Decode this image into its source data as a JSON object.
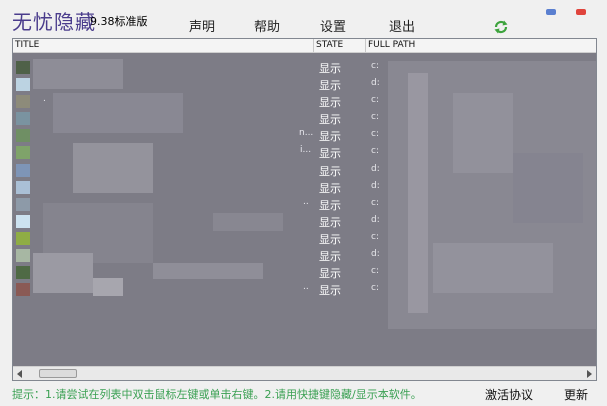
{
  "app": {
    "title": "无忧隐藏",
    "version": "9.38标准版"
  },
  "menu": [
    {
      "label": "声明"
    },
    {
      "label": "帮助"
    },
    {
      "label": "设置"
    },
    {
      "label": "退出"
    }
  ],
  "icons": {
    "refresh": "refresh-icon",
    "minimize": "minimize-icon",
    "close": "close-icon"
  },
  "colors": {
    "title": "#4a3c8c",
    "tip": "#3aa052",
    "list_overlay": "#7d7c86"
  },
  "table": {
    "columns": [
      "TITLE",
      "STATE",
      "FULL PATH"
    ],
    "rows": [
      {
        "swatch": "#4f6148",
        "tail": "",
        "state": "显示",
        "path": "c:"
      },
      {
        "swatch": "#bcd3e2",
        "tail": "",
        "state": "显示",
        "path": "d:"
      },
      {
        "swatch": "#8d8b7a",
        "tail": ".",
        "state": "显示",
        "path": "c:"
      },
      {
        "swatch": "#7a93a0",
        "tail": "",
        "state": "显示",
        "path": "c:"
      },
      {
        "swatch": "#6f8f64",
        "tail": "n...",
        "state": "显示",
        "path": "c:"
      },
      {
        "swatch": "#7fa36a",
        "tail": "i...",
        "state": "显示",
        "path": "c:"
      },
      {
        "swatch": "#7e95b7",
        "tail": "",
        "state": "显示",
        "path": "d:"
      },
      {
        "swatch": "#aac0d6",
        "tail": "",
        "state": "显示",
        "path": "d:"
      },
      {
        "swatch": "#8d9aa8",
        "tail": "..",
        "state": "显示",
        "path": "c:"
      },
      {
        "swatch": "#cce2f0",
        "tail": "",
        "state": "显示",
        "path": "d:"
      },
      {
        "swatch": "#8fad45",
        "tail": "",
        "state": "显示",
        "path": "c:"
      },
      {
        "swatch": "#a7b7a3",
        "tail": "",
        "state": "显示",
        "path": "d:"
      },
      {
        "swatch": "#4f6a45",
        "tail": "",
        "state": "显示",
        "path": "c:"
      },
      {
        "swatch": "#8a5a55",
        "tail": "..",
        "state": "显示",
        "path": "c:"
      }
    ]
  },
  "status": {
    "tip": "提示：1.请尝试在列表中双击鼠标左键或单击右键。2.请用快捷键隐藏/显示本软件。",
    "activate": "激活协议",
    "update": "更新"
  }
}
